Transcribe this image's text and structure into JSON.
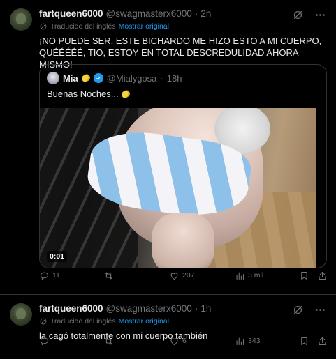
{
  "tweets": [
    {
      "author_name": "fartqueen6000",
      "handle": "@swagmasterx6000",
      "separator": "·",
      "time": "2h",
      "translated_label": "Traducido del inglés",
      "show_original": "Mostrar original",
      "text": "¡NO PUEDE SER, ESTE BICHARDO ME HIZO ESTO A MI CUERPO, QUÉÉÉÉÉ, TIO, ESTOY EN TOTAL DESCREDULIDAD AHORA MISMO!",
      "quote": {
        "author_name": "Mia",
        "handle": "@Mialygosa",
        "separator": "·",
        "time": "18h",
        "text": "Buenas Noches...",
        "video_time": "0:01"
      },
      "stats": {
        "replies": "11",
        "retweets": "",
        "likes": "207",
        "views": "3 mil"
      }
    },
    {
      "author_name": "fartqueen6000",
      "handle": "@swagmasterx6000",
      "separator": "·",
      "time": "1h",
      "translated_label": "Traducido del inglés",
      "show_original": "Mostrar original",
      "text": "la cagó totalmente con mi cuerpo también",
      "stats": {
        "replies": "",
        "retweets": "",
        "likes": "6",
        "views": "343"
      }
    }
  ],
  "colors": {
    "background": "#000000",
    "text": "#e7e9ea",
    "muted": "#71767b",
    "link": "#1d9bf0",
    "border": "#2f3336"
  },
  "icons": [
    "grok-icon",
    "more-icon",
    "translate-icon",
    "verified-icon",
    "reply-icon",
    "retweet-icon",
    "like-icon",
    "views-icon",
    "bookmark-icon",
    "share-icon"
  ]
}
